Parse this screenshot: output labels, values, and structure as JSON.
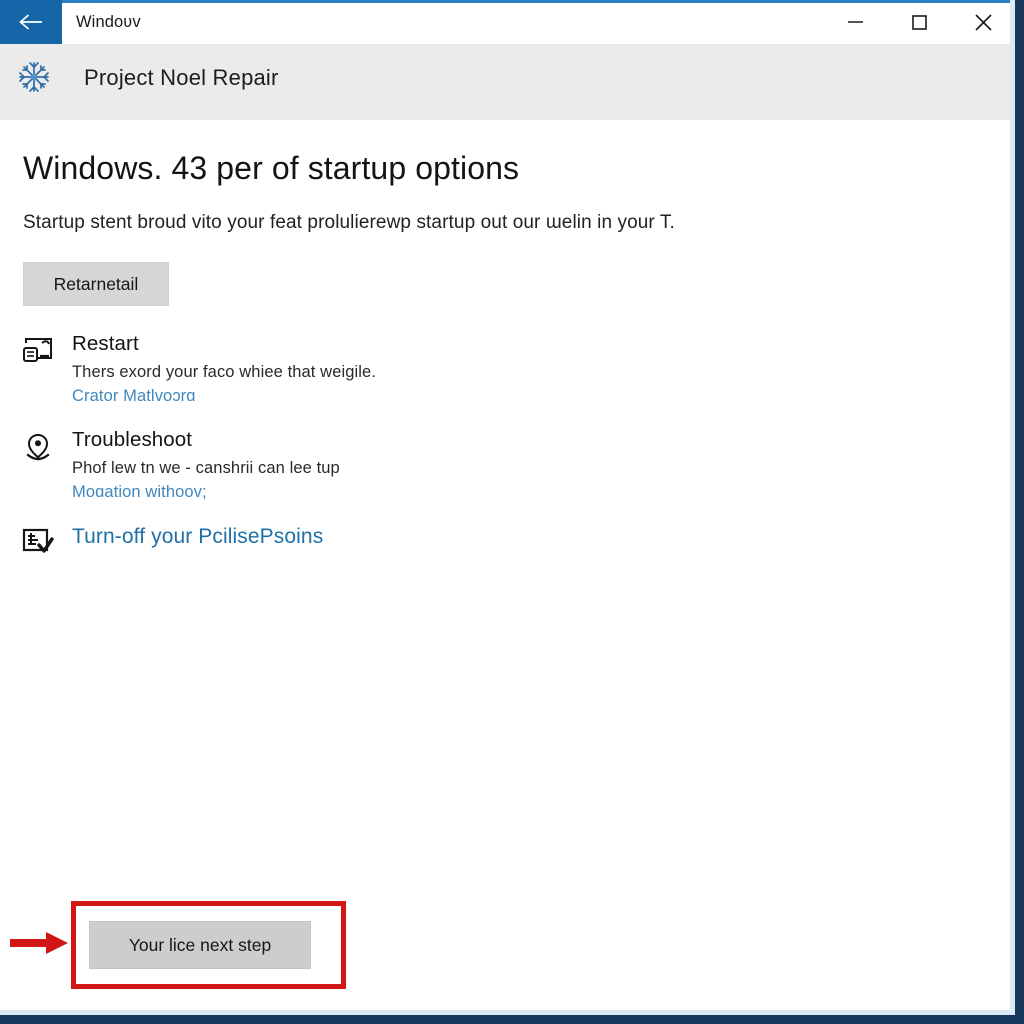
{
  "titlebar": {
    "back_icon": "back-arrow-icon",
    "title": "Windoʋv",
    "minimize_label": "—",
    "maximize_label": "□",
    "close_label": "✕",
    "accent_color": "#2b7fc4",
    "back_button_color": "#1565a8"
  },
  "app_header": {
    "icon": "snowflake-icon",
    "title": "Project Noel Repair",
    "background": "#ebebeb"
  },
  "main": {
    "heading": "Windows. 43 per of startup options",
    "subheading": "Startup stent broud vitо your feat prolulierewp startup out our ɯelin in your T.",
    "primary_button": "Retarnetail",
    "options": [
      {
        "icon": "restart-display-icon",
        "title": "Restart",
        "description": "Thers exord your faco whiee that weigile.",
        "link": "Crator Matlvoɔrɑ",
        "is_link_title": false
      },
      {
        "icon": "location-pin-icon",
        "title": "Troubleshoot",
        "description": "Phof lew tn we - canshrii can lee tup",
        "link": "Moɑation withoov;",
        "is_link_title": false
      },
      {
        "icon": "checklist-document-icon",
        "title": "Turn-off your PcilisePsoins",
        "description": "",
        "link": "",
        "is_link_title": true
      }
    ]
  },
  "callout": {
    "arrow_icon": "red-arrow-right-icon",
    "box_color": "#d11616",
    "button_label": "Your lice next step"
  }
}
